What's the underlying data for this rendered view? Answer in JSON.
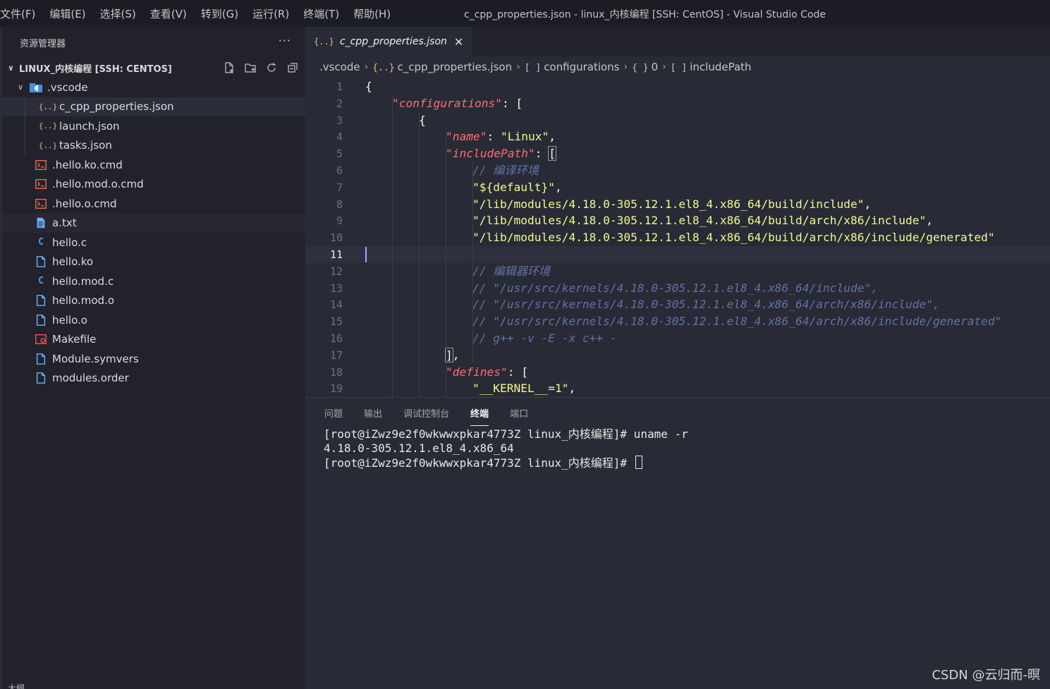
{
  "menu": [
    "文件(F)",
    "编辑(E)",
    "选择(S)",
    "查看(V)",
    "转到(G)",
    "运行(R)",
    "终端(T)",
    "帮助(H)"
  ],
  "window_title": "c_cpp_properties.json - linux_内核编程 [SSH: CentOS] - Visual Studio Code",
  "explorer": {
    "title": "资源管理器",
    "more": "···",
    "workspace": "LINUX_内核编程 [SSH: CENTOS]",
    "outline_label": "大纲"
  },
  "tree": [
    {
      "label": ".vscode",
      "icon": "folder-vscode-icon",
      "level": "folder"
    },
    {
      "label": "c_cpp_properties.json",
      "icon": "json-icon",
      "level": "child",
      "selected": true
    },
    {
      "label": "launch.json",
      "icon": "json-icon",
      "level": "child"
    },
    {
      "label": "tasks.json",
      "icon": "json-icon",
      "level": "child"
    },
    {
      "label": ".hello.ko.cmd",
      "icon": "shell-icon",
      "level": "root"
    },
    {
      "label": ".hello.mod.o.cmd",
      "icon": "shell-icon",
      "level": "root"
    },
    {
      "label": ".hello.o.cmd",
      "icon": "shell-icon",
      "level": "root"
    },
    {
      "label": "a.txt",
      "icon": "text-file-icon",
      "level": "root",
      "hover": true
    },
    {
      "label": "hello.c",
      "icon": "c-file-icon",
      "level": "root"
    },
    {
      "label": "hello.ko",
      "icon": "file-icon",
      "level": "root"
    },
    {
      "label": "hello.mod.c",
      "icon": "c-file-icon",
      "level": "root"
    },
    {
      "label": "hello.mod.o",
      "icon": "file-icon",
      "level": "root"
    },
    {
      "label": "hello.o",
      "icon": "file-icon",
      "level": "root"
    },
    {
      "label": "Makefile",
      "icon": "makefile-icon",
      "level": "root"
    },
    {
      "label": "Module.symvers",
      "icon": "file-icon",
      "level": "root"
    },
    {
      "label": "modules.order",
      "icon": "file-icon",
      "level": "root"
    }
  ],
  "tab": {
    "braces": "{..}",
    "label": "c_cpp_properties.json",
    "close": "✕"
  },
  "breadcrumb": [
    {
      "label": ".vscode",
      "icon": ""
    },
    {
      "label": "c_cpp_properties.json",
      "icon": "{..}"
    },
    {
      "label": "configurations",
      "icon": "[ ]"
    },
    {
      "label": "0",
      "icon": "{ }"
    },
    {
      "label": "includePath",
      "icon": "[ ]"
    }
  ],
  "code": [
    {
      "n": "1",
      "indent": 0,
      "parts": [
        [
          "p",
          "{"
        ]
      ]
    },
    {
      "n": "2",
      "indent": 1,
      "parts": [
        [
          "k",
          "\"configurations\""
        ],
        [
          "p",
          ": ["
        ]
      ]
    },
    {
      "n": "3",
      "indent": 2,
      "parts": [
        [
          "p",
          "{"
        ]
      ]
    },
    {
      "n": "4",
      "indent": 3,
      "parts": [
        [
          "k",
          "\"name\""
        ],
        [
          "p",
          ": "
        ],
        [
          "s",
          "\"Linux\""
        ],
        [
          "p",
          ","
        ]
      ]
    },
    {
      "n": "5",
      "indent": 3,
      "parts": [
        [
          "k",
          "\"includePath\""
        ],
        [
          "p",
          ": "
        ],
        [
          "b",
          "["
        ]
      ]
    },
    {
      "n": "6",
      "indent": 4,
      "parts": [
        [
          "c",
          "// 编译环境"
        ]
      ]
    },
    {
      "n": "7",
      "indent": 4,
      "parts": [
        [
          "s",
          "\"${default}\""
        ],
        [
          "p",
          ","
        ]
      ]
    },
    {
      "n": "8",
      "indent": 4,
      "parts": [
        [
          "s",
          "\"/lib/modules/4.18.0-305.12.1.el8_4.x86_64/build/include\""
        ],
        [
          "p",
          ","
        ]
      ]
    },
    {
      "n": "9",
      "indent": 4,
      "parts": [
        [
          "s",
          "\"/lib/modules/4.18.0-305.12.1.el8_4.x86_64/build/arch/x86/include\""
        ],
        [
          "p",
          ","
        ]
      ]
    },
    {
      "n": "10",
      "indent": 4,
      "parts": [
        [
          "s",
          "\"/lib/modules/4.18.0-305.12.1.el8_4.x86_64/build/arch/x86/include/generated\""
        ]
      ]
    },
    {
      "n": "11",
      "indent": 0,
      "parts": [],
      "current": true
    },
    {
      "n": "12",
      "indent": 4,
      "parts": [
        [
          "c",
          "// 编辑器环境"
        ]
      ]
    },
    {
      "n": "13",
      "indent": 4,
      "parts": [
        [
          "c",
          "// \"/usr/src/kernels/4.18.0-305.12.1.el8_4.x86_64/include\","
        ]
      ]
    },
    {
      "n": "14",
      "indent": 4,
      "parts": [
        [
          "c",
          "// \"/usr/src/kernels/4.18.0-305.12.1.el8_4.x86_64/arch/x86/include\","
        ]
      ]
    },
    {
      "n": "15",
      "indent": 4,
      "parts": [
        [
          "c",
          "// \"/usr/src/kernels/4.18.0-305.12.1.el8_4.x86_64/arch/x86/include/generated\""
        ]
      ]
    },
    {
      "n": "16",
      "indent": 4,
      "parts": [
        [
          "c",
          "// g++ -v -E -x c++ -"
        ]
      ]
    },
    {
      "n": "17",
      "indent": 3,
      "parts": [
        [
          "b",
          "]"
        ],
        [
          "p",
          ","
        ]
      ]
    },
    {
      "n": "18",
      "indent": 3,
      "parts": [
        [
          "k",
          "\"defines\""
        ],
        [
          "p",
          ": ["
        ]
      ]
    },
    {
      "n": "19",
      "indent": 4,
      "parts": [
        [
          "s",
          "\"__KERNEL__=1\""
        ],
        [
          "p",
          ","
        ]
      ]
    }
  ],
  "panel": {
    "tabs": [
      "问题",
      "输出",
      "调试控制台",
      "终端",
      "端口"
    ],
    "active_tab": "终端",
    "terminal": [
      "[root@iZwz9e2f0wkwwxpkar4773Z linux_内核编程]# uname -r",
      "4.18.0-305.12.1.el8_4.x86_64",
      "[root@iZwz9e2f0wkwwxpkar4773Z linux_内核编程]# "
    ]
  },
  "watermark": "CSDN @云归而-暝",
  "colors": {
    "key": "#ff6e6e",
    "string": "#f1fa8c",
    "comment": "#6272a4",
    "json_icon": "#e5c07b",
    "shell_icon": "#e06c4a",
    "file_icon": "#6ab0f3",
    "c_icon": "#4d9fe0",
    "makefile_icon": "#ef5350"
  }
}
